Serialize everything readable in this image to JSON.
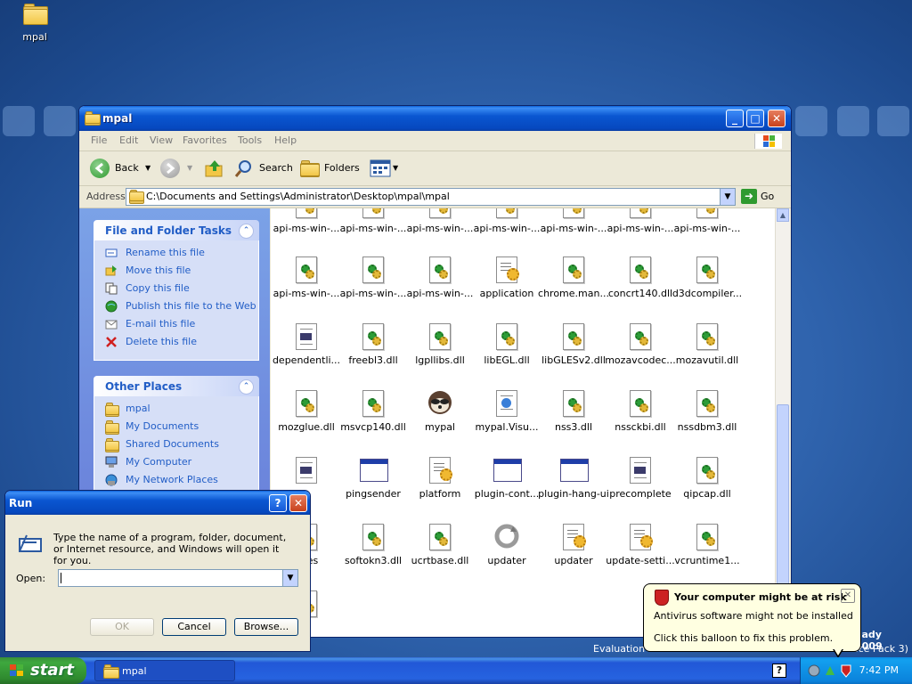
{
  "desktop": {
    "icon_label": "mpal",
    "watermark_line1": "eady 2009",
    "watermark_line2": "vice Pack 3)",
    "evaluation_text": "Evaluation c"
  },
  "window": {
    "title": "mpal",
    "menu": [
      "File",
      "Edit",
      "View",
      "Favorites",
      "Tools",
      "Help"
    ],
    "toolbar": {
      "back": "Back",
      "search": "Search",
      "folders": "Folders"
    },
    "address": {
      "label": "Address",
      "path": "C:\\Documents and Settings\\Administrator\\Desktop\\mpal\\mpal",
      "go": "Go"
    }
  },
  "file_tasks": {
    "title": "File and Folder Tasks",
    "items": [
      {
        "label": "Rename this file",
        "icon": "rename-icon"
      },
      {
        "label": "Move this file",
        "icon": "move-icon"
      },
      {
        "label": "Copy this file",
        "icon": "copy-icon"
      },
      {
        "label": "Publish this file to the Web",
        "icon": "publish-icon"
      },
      {
        "label": "E-mail this file",
        "icon": "email-icon"
      },
      {
        "label": "Delete this file",
        "icon": "delete-icon"
      }
    ]
  },
  "other_places": {
    "title": "Other Places",
    "items": [
      {
        "label": "mpal",
        "icon": "folder-icon"
      },
      {
        "label": "My Documents",
        "icon": "folder-icon"
      },
      {
        "label": "Shared Documents",
        "icon": "folder-icon"
      },
      {
        "label": "My Computer",
        "icon": "computer-icon"
      },
      {
        "label": "My Network Places",
        "icon": "network-icon"
      }
    ]
  },
  "files": [
    {
      "label": "api-ms-win-...",
      "type": "dll"
    },
    {
      "label": "api-ms-win-...",
      "type": "dll"
    },
    {
      "label": "api-ms-win-...",
      "type": "dll"
    },
    {
      "label": "api-ms-win-...",
      "type": "dll"
    },
    {
      "label": "api-ms-win-...",
      "type": "dll"
    },
    {
      "label": "api-ms-win-...",
      "type": "dll"
    },
    {
      "label": "api-ms-win-...",
      "type": "dll"
    },
    {
      "label": "api-ms-win-...",
      "type": "dll"
    },
    {
      "label": "api-ms-win-...",
      "type": "dll"
    },
    {
      "label": "api-ms-win-...",
      "type": "dll"
    },
    {
      "label": "application",
      "type": "cfg"
    },
    {
      "label": "chrome.man...",
      "type": "dll"
    },
    {
      "label": "concrt140.dll",
      "type": "dll"
    },
    {
      "label": "d3dcompiler...",
      "type": "dll"
    },
    {
      "label": "dependentli...",
      "type": "txt"
    },
    {
      "label": "freebl3.dll",
      "type": "dll"
    },
    {
      "label": "lgpllibs.dll",
      "type": "dll"
    },
    {
      "label": "libEGL.dll",
      "type": "dll"
    },
    {
      "label": "libGLESv2.dll",
      "type": "dll"
    },
    {
      "label": "mozavcodec...",
      "type": "dll"
    },
    {
      "label": "mozavutil.dll",
      "type": "dll"
    },
    {
      "label": "mozglue.dll",
      "type": "dll"
    },
    {
      "label": "msvcp140.dll",
      "type": "dll"
    },
    {
      "label": "mypal",
      "type": "app"
    },
    {
      "label": "mypal.Visu...",
      "type": "manifest"
    },
    {
      "label": "nss3.dll",
      "type": "dll"
    },
    {
      "label": "nssckbi.dll",
      "type": "dll"
    },
    {
      "label": "nssdbm3.dll",
      "type": "dll"
    },
    {
      "label": "ja",
      "type": "txt"
    },
    {
      "label": "pingsender",
      "type": "exe"
    },
    {
      "label": "platform",
      "type": "cfg"
    },
    {
      "label": "plugin-cont...",
      "type": "exe"
    },
    {
      "label": "plugin-hang-ui",
      "type": "exe"
    },
    {
      "label": "precomplete",
      "type": "txt"
    },
    {
      "label": "qipcap.dll",
      "type": "dll"
    },
    {
      "label": "-files",
      "type": "dll"
    },
    {
      "label": "softokn3.dll",
      "type": "dll"
    },
    {
      "label": "ucrtbase.dll",
      "type": "dll"
    },
    {
      "label": "updater",
      "type": "updater"
    },
    {
      "label": "updater",
      "type": "cfg"
    },
    {
      "label": "update-setti...",
      "type": "cfg"
    },
    {
      "label": "vcruntime1...",
      "type": "dll"
    },
    {
      "label": "ll",
      "type": "dll"
    }
  ],
  "run_dialog": {
    "title": "Run",
    "description": "Type the name of a program, folder, document, or Internet resource, and Windows will open it for you.",
    "open_label": "Open:",
    "open_value": "",
    "ok": "OK",
    "cancel": "Cancel",
    "browse": "Browse..."
  },
  "taskbar": {
    "start": "start",
    "task": "mpal",
    "clock": "7:42 PM"
  },
  "balloon": {
    "title": "Your computer might be at risk",
    "line1": "Antivirus software might not be installed",
    "line2": "Click this balloon to fix this problem."
  }
}
